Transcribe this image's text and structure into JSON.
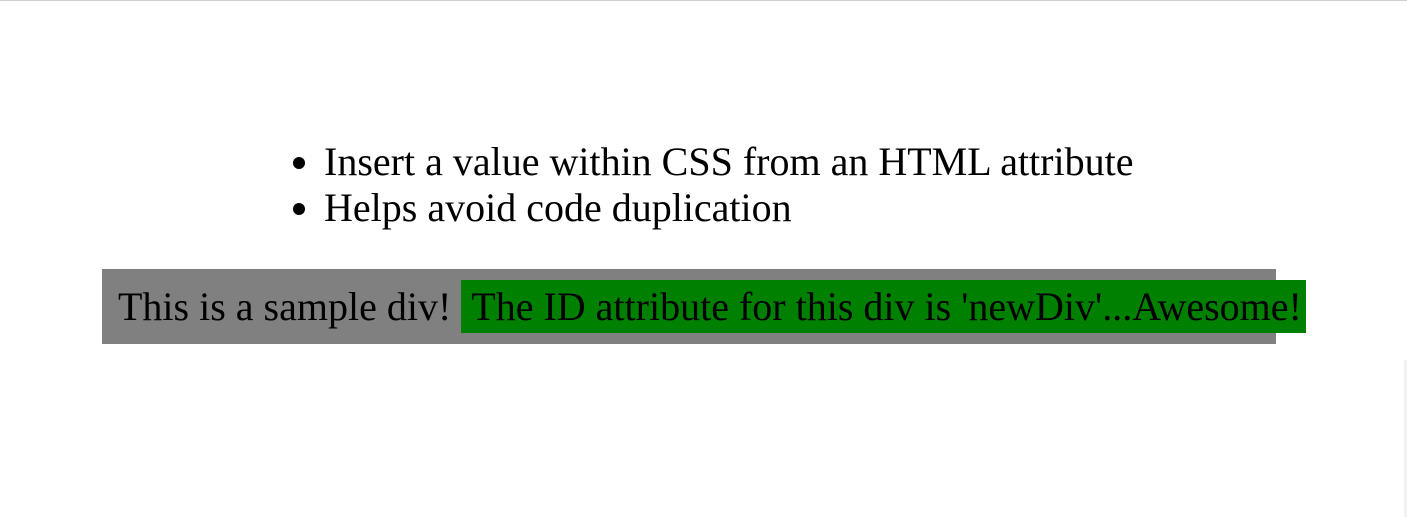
{
  "list": {
    "items": [
      "Insert a value within CSS from an HTML attribute",
      "Helps avoid code duplication"
    ]
  },
  "sample": {
    "text": "This is a sample div!",
    "after_text": "The ID attribute for this div is 'newDiv'...Awesome!"
  },
  "colors": {
    "sample_background": "#808080",
    "after_background": "#008000"
  }
}
